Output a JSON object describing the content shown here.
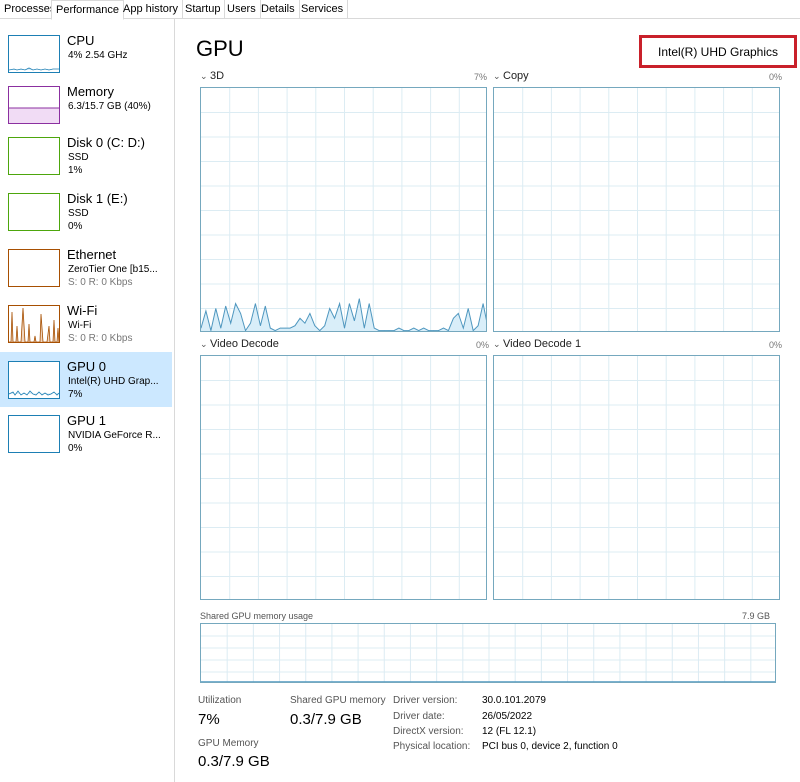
{
  "tabs": [
    "Processes",
    "Performance",
    "App history",
    "Startup",
    "Users",
    "Details",
    "Services"
  ],
  "active_tab": "Performance",
  "sidebar": {
    "items": [
      {
        "title": "CPU",
        "sub1": "4% 2.54 GHz",
        "sub2": "",
        "color": "#1d7fb4",
        "active": false
      },
      {
        "title": "Memory",
        "sub1": "6.3/15.7 GB (40%)",
        "sub2": "",
        "color": "#8b2fa0",
        "active": false
      },
      {
        "title": "Disk 0 (C: D:)",
        "sub1": "SSD",
        "sub2": "1%",
        "color": "#4da60c",
        "active": false
      },
      {
        "title": "Disk 1 (E:)",
        "sub1": "SSD",
        "sub2": "0%",
        "color": "#4da60c",
        "active": false
      },
      {
        "title": "Ethernet",
        "sub1": "ZeroTier One [b15...",
        "sub2": "S: 0 R: 0 Kbps",
        "color": "#a74f01",
        "active": false
      },
      {
        "title": "Wi-Fi",
        "sub1": "Wi-Fi",
        "sub2": "S: 0 R: 0 Kbps",
        "color": "#a74f01",
        "active": false
      },
      {
        "title": "GPU 0",
        "sub1": "Intel(R) UHD Grap...",
        "sub2": "7%",
        "color": "#1d7fb4",
        "active": true
      },
      {
        "title": "GPU 1",
        "sub1": "NVIDIA GeForce R...",
        "sub2": "0%",
        "color": "#1d7fb4",
        "active": false
      }
    ]
  },
  "main": {
    "title": "GPU",
    "device_name": "Intel(R) UHD Graphics",
    "charts": [
      {
        "label": "3D",
        "percent": "7%"
      },
      {
        "label": "Copy",
        "percent": "0%"
      },
      {
        "label": "Video Decode",
        "percent": "0%"
      },
      {
        "label": "Video Decode 1",
        "percent": "0%"
      }
    ],
    "shared_memory_label": "Shared GPU memory usage",
    "shared_memory_max": "7.9 GB"
  },
  "chart_data": {
    "type": "line",
    "title": "3D",
    "ylim": [
      0,
      100
    ],
    "series": [
      {
        "values": [
          2,
          9,
          1,
          10,
          2,
          11,
          4,
          12,
          8,
          1,
          4,
          12,
          3,
          11,
          2,
          1,
          2,
          2,
          2,
          3,
          6,
          4,
          8,
          3,
          1,
          3,
          10,
          6,
          12,
          2,
          12,
          5,
          14,
          2,
          12,
          2,
          1,
          1,
          1,
          1,
          2,
          1,
          1,
          2,
          1,
          2,
          1,
          1,
          1,
          2,
          1,
          6,
          8,
          2,
          10,
          1,
          3,
          12,
          2
        ]
      }
    ]
  },
  "stats": {
    "utilization_label": "Utilization",
    "utilization_value": "7%",
    "shared_label": "Shared GPU memory",
    "shared_value": "0.3/7.9 GB",
    "gpu_mem_label": "GPU Memory",
    "gpu_mem_value": "0.3/7.9 GB"
  },
  "info": {
    "driver_version_label": "Driver version:",
    "driver_version": "30.0.101.2079",
    "driver_date_label": "Driver date:",
    "driver_date": "26/05/2022",
    "directx_label": "DirectX version:",
    "directx": "12 (FL 12.1)",
    "location_label": "Physical location:",
    "location": "PCI bus 0, device 2, function 0"
  }
}
